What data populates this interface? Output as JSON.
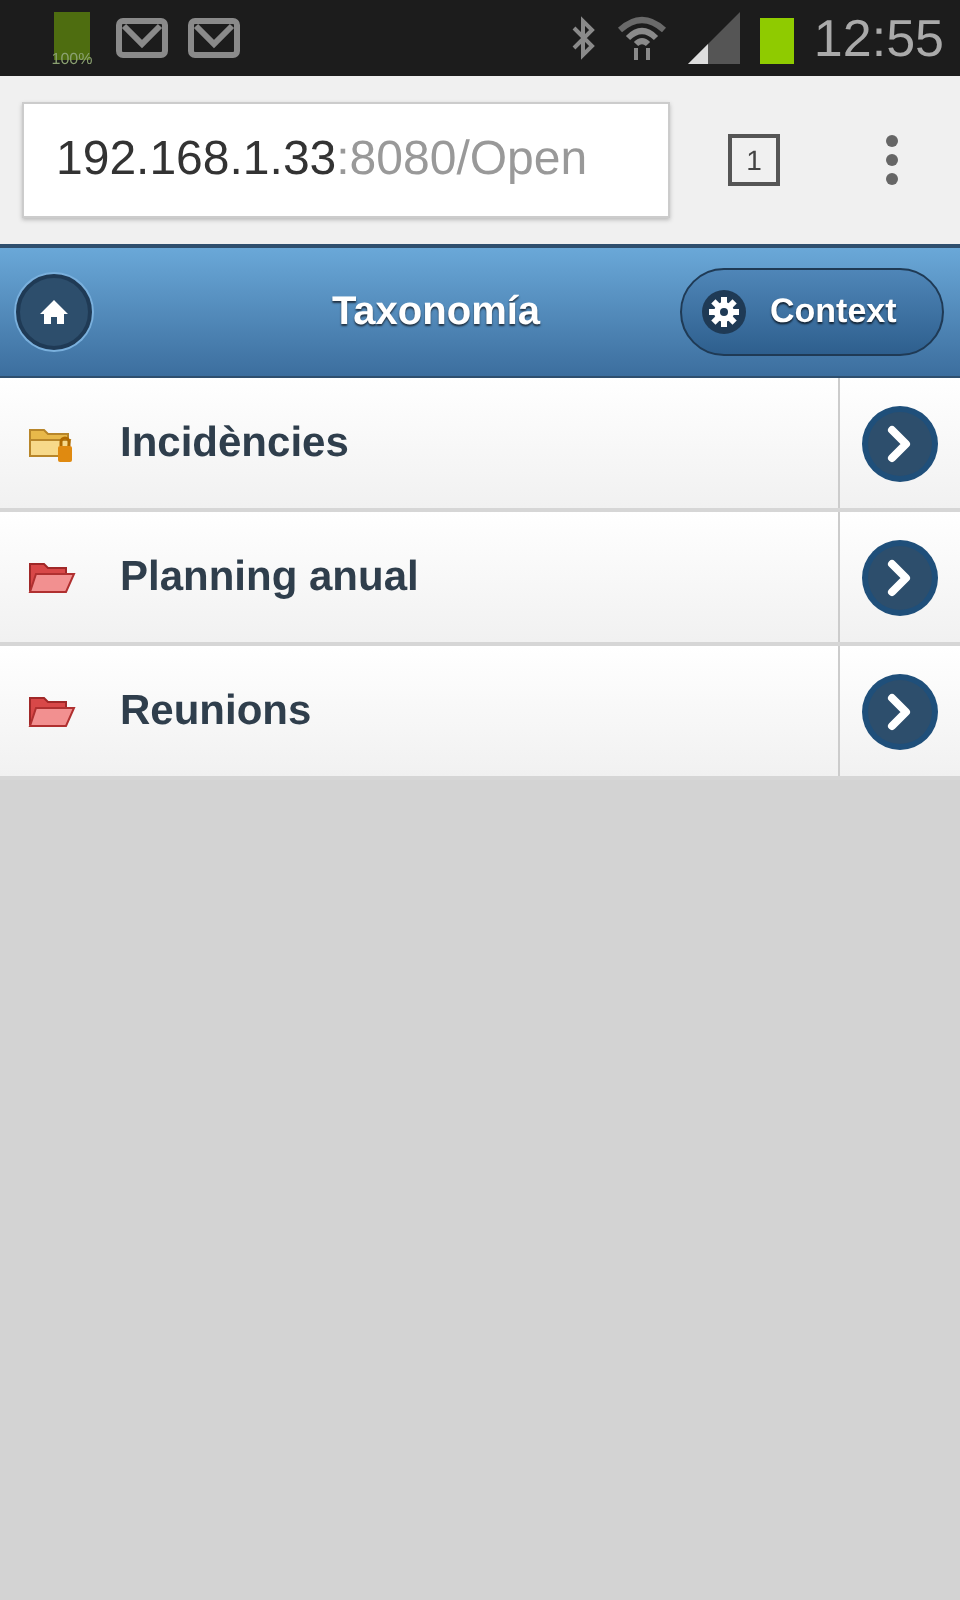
{
  "status_bar": {
    "battery_label": "100%",
    "time": "12:55"
  },
  "browser": {
    "url_host": "192.168.1.33",
    "url_rest": ":8080/Open",
    "tab_count": "1"
  },
  "header": {
    "title": "Taxonomía",
    "context_button": "Context"
  },
  "items": [
    {
      "label": "Incidències",
      "kind": "locked"
    },
    {
      "label": "Planning anual",
      "kind": "open"
    },
    {
      "label": "Reunions",
      "kind": "open"
    }
  ]
}
